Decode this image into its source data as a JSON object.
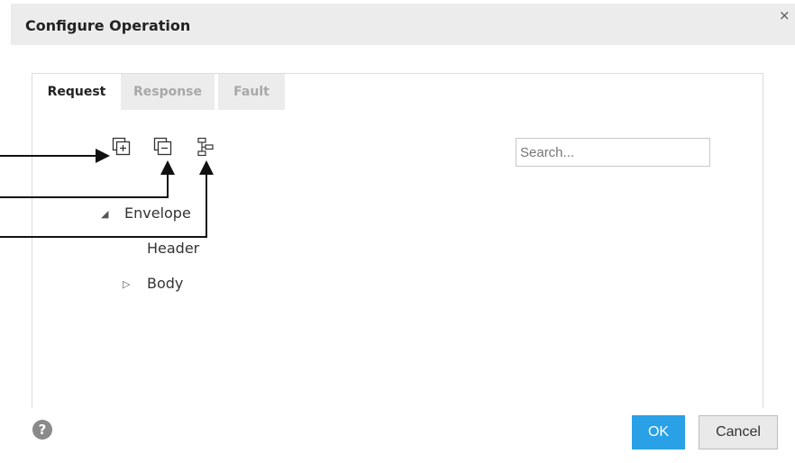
{
  "dialog": {
    "title": "Configure Operation",
    "close_label": "×"
  },
  "tabs": [
    {
      "label": "Request",
      "active": true
    },
    {
      "label": "Response",
      "active": false
    },
    {
      "label": "Fault",
      "active": false
    }
  ],
  "toolbar": {
    "icons": [
      "expand-all-icon",
      "collapse-all-icon",
      "hierarchy-icon"
    ]
  },
  "search": {
    "placeholder": "Search..."
  },
  "tree": {
    "nodes": [
      {
        "label": "Envelope",
        "toggle": "◢",
        "expanded": true
      },
      {
        "label": "Header"
      },
      {
        "label": "Body",
        "toggle": "▷",
        "expanded": false
      }
    ]
  },
  "footer": {
    "help_label": "?",
    "ok_label": "OK",
    "cancel_label": "Cancel"
  },
  "colors": {
    "header_bg": "#ececec",
    "primary_button": "#2aa0e6",
    "tab_inactive_text": "#a8a8a8"
  }
}
